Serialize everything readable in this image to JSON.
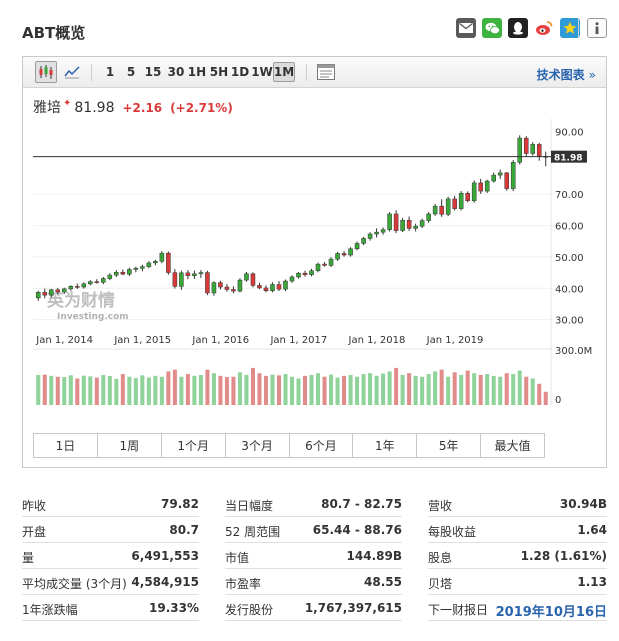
{
  "page": {
    "title": "ABT概览"
  },
  "share_icons": [
    {
      "name": "email-icon",
      "color": "#555555"
    },
    {
      "name": "wechat-icon",
      "color": "#3fb33f"
    },
    {
      "name": "qq-icon",
      "color": "#222222"
    },
    {
      "name": "weibo-icon",
      "color": "#e64141"
    },
    {
      "name": "qzone-icon",
      "color": "#2f9bd8"
    },
    {
      "name": "info-icon",
      "color": "#666666"
    }
  ],
  "toolbar": {
    "intervals": [
      "1",
      "5",
      "15",
      "30",
      "1H",
      "5H",
      "1D",
      "1W",
      "1M"
    ],
    "active_interval": "1M",
    "tech_chart_label": "技术图表",
    "tech_chart_arrow": "»"
  },
  "quote": {
    "name": "雅培",
    "star": "✦",
    "price": "81.98",
    "change": "+2.16",
    "change_pct": "(+2.71%)"
  },
  "watermark": {
    "line1": "英为财情",
    "line2": "Investing.com"
  },
  "chart_data": {
    "type": "candlestick",
    "price_axis": {
      "ticks": [
        30,
        40,
        50,
        60,
        70
      ],
      "top_label": "90.00",
      "range": [
        27,
        94
      ]
    },
    "last_price_label": "81.98",
    "last_price": 81.98,
    "x_labels": [
      "Jan 1, 2014",
      "Jan 1, 2015",
      "Jan 1, 2016",
      "Jan 1, 2017",
      "Jan 1, 2018",
      "Jan 1, 2019"
    ],
    "volume_axis": {
      "top_label": "300.0M",
      "bottom_label": "0",
      "max": 300
    },
    "candles": [
      [
        36.9,
        39.2,
        36.0,
        38.7
      ],
      [
        38.7,
        39.9,
        36.8,
        37.8
      ],
      [
        37.8,
        39.8,
        37.1,
        39.5
      ],
      [
        39.5,
        40.1,
        38.1,
        38.8
      ],
      [
        38.8,
        40.2,
        38.2,
        39.8
      ],
      [
        39.8,
        41.0,
        39.2,
        40.6
      ],
      [
        40.6,
        41.5,
        39.8,
        40.4
      ],
      [
        40.4,
        41.9,
        39.9,
        41.4
      ],
      [
        41.4,
        42.6,
        40.9,
        42.1
      ],
      [
        42.1,
        42.9,
        41.5,
        41.9
      ],
      [
        41.9,
        43.6,
        41.3,
        43.1
      ],
      [
        43.1,
        44.8,
        42.6,
        44.2
      ],
      [
        44.2,
        45.8,
        43.6,
        45.1
      ],
      [
        45.1,
        46.0,
        44.2,
        44.5
      ],
      [
        44.5,
        46.6,
        43.9,
        46.0
      ],
      [
        46.0,
        46.9,
        45.1,
        46.4
      ],
      [
        46.4,
        47.5,
        45.4,
        46.9
      ],
      [
        46.9,
        48.6,
        46.4,
        48.1
      ],
      [
        48.1,
        49.1,
        47.3,
        48.6
      ],
      [
        48.6,
        51.8,
        48.0,
        51.2
      ],
      [
        51.2,
        51.7,
        44.3,
        45.0
      ],
      [
        45.0,
        46.1,
        39.9,
        40.6
      ],
      [
        40.6,
        45.6,
        39.5,
        44.9
      ],
      [
        44.9,
        45.8,
        42.9,
        44.0
      ],
      [
        44.0,
        45.6,
        43.0,
        44.6
      ],
      [
        44.6,
        45.8,
        43.3,
        45.0
      ],
      [
        45.0,
        45.6,
        37.8,
        38.5
      ],
      [
        38.5,
        42.2,
        37.6,
        41.8
      ],
      [
        41.8,
        42.4,
        39.6,
        40.4
      ],
      [
        40.4,
        41.3,
        38.9,
        39.6
      ],
      [
        39.6,
        40.6,
        38.4,
        39.1
      ],
      [
        39.1,
        43.2,
        38.7,
        42.6
      ],
      [
        42.6,
        45.2,
        42.1,
        44.6
      ],
      [
        44.6,
        45.1,
        40.3,
        40.9
      ],
      [
        40.9,
        41.8,
        39.7,
        40.1
      ],
      [
        40.1,
        40.9,
        38.7,
        39.2
      ],
      [
        39.2,
        41.9,
        38.7,
        41.2
      ],
      [
        41.2,
        42.3,
        39.1,
        39.7
      ],
      [
        39.7,
        42.8,
        39.1,
        42.3
      ],
      [
        42.3,
        44.1,
        41.7,
        43.6
      ],
      [
        43.6,
        45.2,
        43.1,
        44.8
      ],
      [
        44.8,
        45.6,
        43.7,
        44.3
      ],
      [
        44.3,
        46.2,
        43.8,
        45.6
      ],
      [
        45.6,
        48.2,
        45.1,
        47.7
      ],
      [
        47.7,
        48.4,
        46.9,
        47.3
      ],
      [
        47.3,
        49.9,
        46.8,
        49.3
      ],
      [
        49.3,
        51.6,
        48.7,
        51.1
      ],
      [
        51.1,
        51.9,
        50.1,
        50.6
      ],
      [
        50.6,
        53.1,
        50.1,
        52.6
      ],
      [
        52.6,
        54.9,
        52.1,
        54.3
      ],
      [
        54.3,
        56.4,
        53.8,
        55.9
      ],
      [
        55.9,
        57.9,
        55.2,
        57.3
      ],
      [
        57.3,
        59.1,
        56.2,
        57.9
      ],
      [
        57.9,
        59.4,
        57.1,
        58.7
      ],
      [
        58.7,
        64.3,
        58.1,
        63.7
      ],
      [
        63.7,
        64.9,
        57.6,
        58.4
      ],
      [
        58.4,
        62.4,
        57.9,
        61.7
      ],
      [
        61.7,
        62.9,
        58.3,
        59.1
      ],
      [
        59.1,
        60.6,
        58.1,
        59.8
      ],
      [
        59.8,
        62.2,
        59.2,
        61.6
      ],
      [
        61.6,
        64.3,
        60.9,
        63.7
      ],
      [
        63.7,
        66.9,
        63.1,
        66.2
      ],
      [
        66.2,
        68.4,
        62.8,
        63.6
      ],
      [
        63.6,
        69.2,
        63.0,
        68.5
      ],
      [
        68.5,
        69.5,
        64.8,
        65.4
      ],
      [
        65.4,
        71.0,
        64.9,
        70.3
      ],
      [
        70.3,
        70.9,
        67.4,
        67.9
      ],
      [
        67.9,
        74.4,
        67.3,
        73.6
      ],
      [
        73.6,
        74.9,
        70.1,
        71.0
      ],
      [
        71.0,
        74.6,
        70.4,
        74.2
      ],
      [
        74.2,
        76.9,
        73.7,
        76.1
      ],
      [
        76.1,
        77.9,
        74.9,
        76.8
      ],
      [
        76.8,
        77.1,
        71.1,
        71.8
      ],
      [
        71.8,
        80.9,
        71.0,
        80.2
      ],
      [
        80.2,
        88.8,
        79.5,
        87.9
      ],
      [
        87.9,
        88.5,
        81.9,
        83.0
      ],
      [
        83.0,
        86.6,
        82.3,
        85.9
      ],
      [
        85.9,
        86.4,
        80.7,
        82.1
      ],
      [
        82.1,
        83.6,
        78.9,
        81.98
      ]
    ],
    "volumes": [
      170,
      172,
      165,
      160,
      158,
      168,
      150,
      166,
      162,
      155,
      170,
      164,
      148,
      175,
      160,
      152,
      168,
      156,
      165,
      160,
      190,
      200,
      160,
      175,
      165,
      170,
      200,
      180,
      165,
      158,
      160,
      185,
      170,
      210,
      180,
      165,
      172,
      168,
      175,
      160,
      150,
      165,
      170,
      180,
      160,
      172,
      155,
      165,
      170,
      160,
      175,
      180,
      165,
      178,
      190,
      210,
      170,
      180,
      165,
      160,
      175,
      190,
      200,
      160,
      185,
      170,
      195,
      180,
      170,
      175,
      165,
      160,
      180,
      175,
      195,
      160,
      150,
      120,
      75
    ]
  },
  "periods": [
    "1日",
    "1周",
    "1个月",
    "3个月",
    "6个月",
    "1年",
    "5年",
    "最大值"
  ],
  "stats": [
    [
      {
        "label": "昨收",
        "value": "79.82"
      },
      {
        "label": "开盘",
        "value": "80.7"
      },
      {
        "label": "量",
        "value": "6,491,553"
      },
      {
        "label": "平均成交量 (3个月)",
        "value": "4,584,915"
      },
      {
        "label": "1年涨跌幅",
        "value": "19.33%"
      }
    ],
    [
      {
        "label": "当日幅度",
        "value": "80.7 - 82.75"
      },
      {
        "label": "52 周范围",
        "value": "65.44 - 88.76"
      },
      {
        "label": "市值",
        "value": "144.89B"
      },
      {
        "label": "市盈率",
        "value": "48.55"
      },
      {
        "label": "发行股份",
        "value": "1,767,397,615"
      }
    ],
    [
      {
        "label": "营收",
        "value": "30.94B"
      },
      {
        "label": "每股收益",
        "value": "1.64"
      },
      {
        "label": "股息",
        "value": "1.28 (1.61%)"
      },
      {
        "label": "贝塔",
        "value": "1.13"
      },
      {
        "label": "下一财报日",
        "value": "2019年10月16日"
      }
    ]
  ]
}
